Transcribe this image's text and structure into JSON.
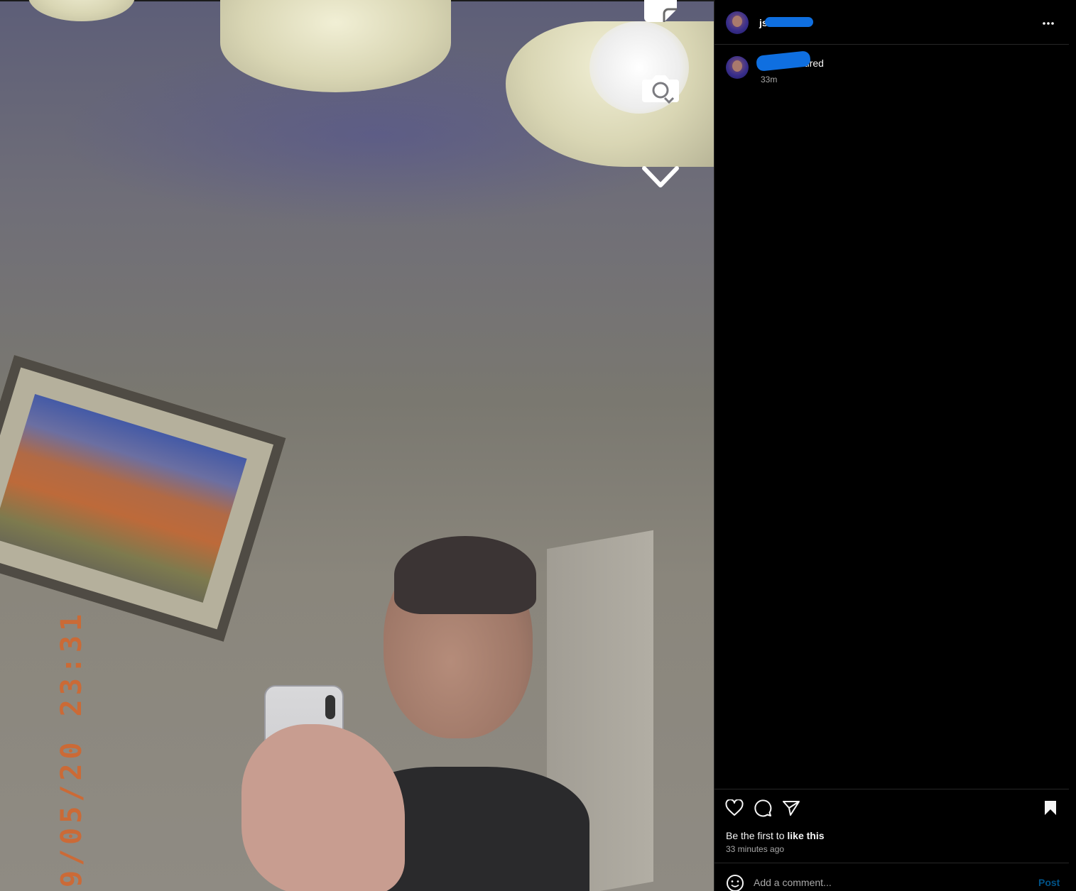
{
  "media": {
    "datestamp": "9/05/20  23:31",
    "controls": {
      "top_icon": "sticker-icon",
      "flip_icon": "camera-flip-icon",
      "down_icon": "chevron-down-icon"
    }
  },
  "header": {
    "username": "js",
    "more_icon": "more-horizontal-icon"
  },
  "comment": {
    "username": "js",
    "text": "tired",
    "time": "33m"
  },
  "actions": {
    "like_icon": "heart-icon",
    "comment_icon": "comment-icon",
    "share_icon": "send-icon",
    "save_icon": "bookmark-icon"
  },
  "likes": {
    "prefix": "Be the first to",
    "emphasis": "like this"
  },
  "posted": "33 minutes ago",
  "add_comment": {
    "placeholder": "Add a comment...",
    "post_label": "Post",
    "emoji_icon": "emoji-icon"
  },
  "colors": {
    "background": "#000000",
    "redaction": "#0f6fe0",
    "datestamp": "#d6652a",
    "post_link": "#0095f6"
  }
}
